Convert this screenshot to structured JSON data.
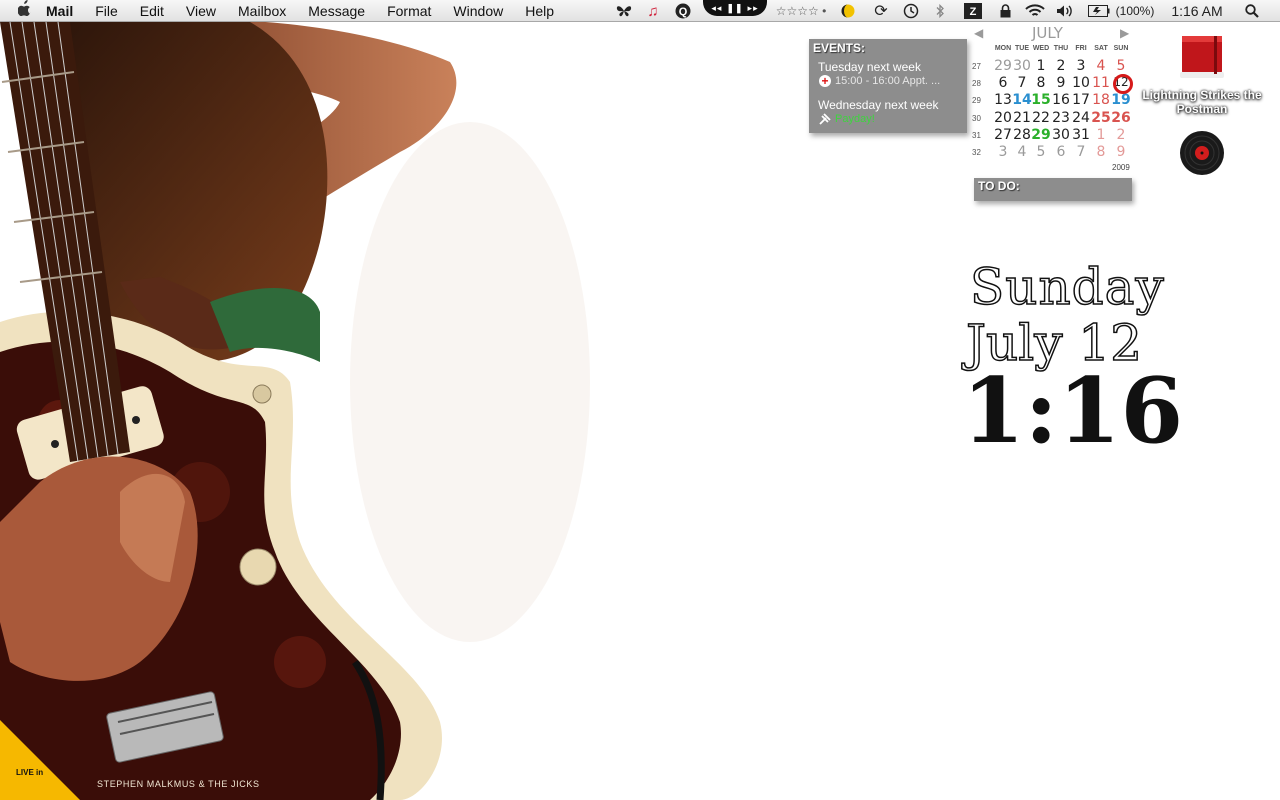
{
  "menubar": {
    "app": "Mail",
    "items": [
      "File",
      "Edit",
      "View",
      "Mailbox",
      "Message",
      "Format",
      "Window",
      "Help"
    ],
    "rating": "☆☆☆☆ •",
    "battery": "(100%)",
    "clock": "1:16 AM"
  },
  "events": {
    "title": "EVENTS:",
    "items": [
      {
        "when": "Tuesday next week",
        "detail": "15:00 - 16:00 Appt. ..."
      },
      {
        "when": "Wednesday next week",
        "detail": "Payday!"
      }
    ]
  },
  "calendar": {
    "month": "JULY",
    "year": "2009",
    "dow": [
      "MON",
      "TUE",
      "WED",
      "THU",
      "FRI",
      "SAT",
      "SUN"
    ],
    "weeks": [
      {
        "wk": "27",
        "days": [
          "29",
          "30",
          "1",
          "2",
          "3",
          "4",
          "5"
        ]
      },
      {
        "wk": "28",
        "days": [
          "6",
          "7",
          "8",
          "9",
          "10",
          "11",
          "12"
        ]
      },
      {
        "wk": "29",
        "days": [
          "13",
          "14",
          "15",
          "16",
          "17",
          "18",
          "19"
        ]
      },
      {
        "wk": "30",
        "days": [
          "20",
          "21",
          "22",
          "23",
          "24",
          "25",
          "26"
        ]
      },
      {
        "wk": "31",
        "days": [
          "27",
          "28",
          "29",
          "30",
          "31",
          "1",
          "2"
        ]
      },
      {
        "wk": "32",
        "days": [
          "3",
          "4",
          "5",
          "6",
          "7",
          "8",
          "9"
        ]
      }
    ],
    "today": "12"
  },
  "todo": {
    "title": "TO DO:"
  },
  "desktop": {
    "itunes_label": "Lightning Strikes the Postman"
  },
  "wallpaper": {
    "caption": "STEPHEN MALKMUS & THE JICKS",
    "poster_text": "LIVE in"
  },
  "bigclock": {
    "day": "Sunday",
    "date": "July 12",
    "time": "1:16"
  },
  "colors": {
    "weekend": "#d9534f",
    "green": "#2bb02b",
    "blue": "#2a8fd0",
    "widget_bg": "#8d8d8d"
  }
}
